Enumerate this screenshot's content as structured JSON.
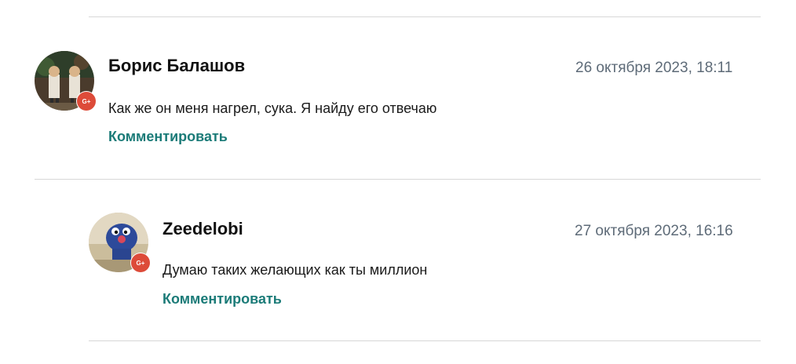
{
  "comments": [
    {
      "author": "Борис Балашов",
      "date": "26 октября 2023, 18:11",
      "text": "Как же он меня нагрел, сука. Я найду его отвечаю",
      "reply_label": "Комментировать",
      "badge": "G+",
      "avatar_icon": "user-photo-avatar"
    },
    {
      "author": "Zeedelobi",
      "date": "27 октября 2023, 16:16",
      "text": "Думаю таких желающих как ты миллион",
      "reply_label": "Комментировать",
      "badge": "G+",
      "avatar_icon": "user-photo-avatar"
    }
  ],
  "colors": {
    "reply_link": "#1b7b78",
    "date_text": "#5e6b78",
    "google_badge": "#dd4b39",
    "divider": "#d7d7d7"
  }
}
